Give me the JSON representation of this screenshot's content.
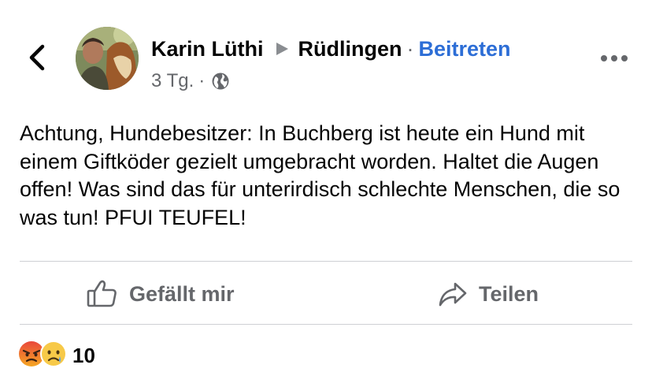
{
  "icons": {
    "back": "chevron-left-icon",
    "separator": "triangle-right-icon",
    "privacy": "globe-icon",
    "more": "more-horizontal-icon",
    "like": "thumbs-up-icon",
    "share": "share-arrow-icon",
    "reactions": [
      "angry-emoji-icon",
      "sad-emoji-icon"
    ]
  },
  "colors": {
    "link": "#2d6ed6",
    "text": "#050505",
    "secondary": "#65676b",
    "divider": "#ced0d4"
  },
  "post": {
    "author": "Karin Lüthi",
    "group": "Rüdlingen",
    "separator_dot": "·",
    "join_label": "Beitreten",
    "time": "3 Tg.",
    "time_dot": "·",
    "text": "Achtung, Hundebesitzer: In Buchberg ist heute ein Hund mit einem Giftköder gezielt umgebracht worden. Haltet die Augen offen! Was sind das für unterirdisch schlechte Menschen, die so was tun! PFUI TEUFEL!"
  },
  "actions": {
    "like_label": "Gefällt mir",
    "share_label": "Teilen"
  },
  "reactions": {
    "count": "10"
  }
}
